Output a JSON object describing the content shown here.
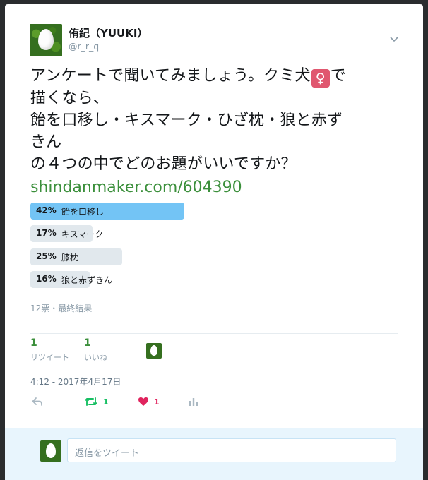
{
  "author": {
    "name": "侑紀（YUUKI）",
    "handle": "@r_r_q"
  },
  "tweet": {
    "lines": [
      "アンケートで聞いてみましょう。クミ犬",
      "描くなら、",
      "飴を口移し・キスマーク・ひざ枕・狼と赤ず",
      "きん",
      "の４つの中でどのお題がいいですか？"
    ],
    "after_emoji": "で",
    "emoji": "♀",
    "link": "shindanmaker.com/604390"
  },
  "poll": {
    "options": [
      {
        "pct": "42%",
        "label": "飴を口移し",
        "value": 42,
        "winner": true
      },
      {
        "pct": "17%",
        "label": "キスマーク",
        "value": 17,
        "winner": false
      },
      {
        "pct": "25%",
        "label": "膝枕",
        "value": 25,
        "winner": false
      },
      {
        "pct": "16%",
        "label": "狼と赤ずきん",
        "value": 16,
        "winner": false
      }
    ],
    "meta": "12票・最終結果"
  },
  "stats": {
    "retweets": {
      "count": "1",
      "label": "リツイート"
    },
    "likes": {
      "count": "1",
      "label": "いいね"
    }
  },
  "timestamp": "4:12 - 2017年4月17日",
  "actions": {
    "retweet_count": "1",
    "like_count": "1"
  },
  "reply": {
    "placeholder": "返信をツイート"
  },
  "colors": {
    "accent": "#3b8f3b",
    "poll_winner": "#73c4f5",
    "poll_other": "#e1e8ed",
    "like": "#e0245e"
  }
}
